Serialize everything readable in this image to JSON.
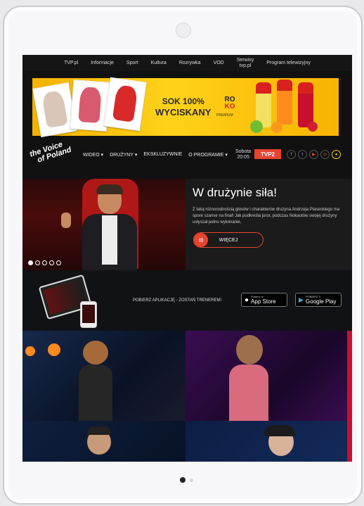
{
  "top_nav": {
    "items": [
      "TVP.pl",
      "Informacje",
      "Sport",
      "Kultura",
      "Rozrywka",
      "VOD"
    ],
    "serwisy_line1": "Serwisy",
    "serwisy_line2": "tvp.pl",
    "program": "Program telewizyjny"
  },
  "ad": {
    "slogan_line1": "SOK 100%",
    "slogan_line2": "WYCISKANY",
    "brand": "RO",
    "brand2": "KO",
    "brand_sub": "PREMIUM"
  },
  "main_nav": {
    "logo_line1": "the Voice",
    "logo_line2": "of Poland",
    "menu": [
      "WIDEO ▾",
      "DRUŻYNY ▾",
      "EKSKLUZYWNIE",
      "O PROGRAMIE ▾"
    ],
    "broadcast_day": "Sobota",
    "broadcast_time": "20:05",
    "channel": "TVP2"
  },
  "hero": {
    "title": "W drużynie siła!",
    "text": "Z taką różnorodnością głosów i charakterów drużyna Andrzeja Piaseckiego ma spore szanse na finał! Jak podkreśla juror, podczas Nokautów swojej drużyny usłyszał jedno wykonanie,",
    "button": "WIĘCEJ",
    "slides": 5,
    "active_slide": 1
  },
  "app_promo": {
    "text": "POBIERZ APLIKACJĘ - ZOSTAŃ TRENEREM!",
    "app_store_small": "Pobierz w",
    "app_store_big": "App Store",
    "google_small": "POBIERZ Z",
    "google_big": "Google Play"
  },
  "colors": {
    "accent": "#e8432f",
    "dark": "#111111"
  }
}
